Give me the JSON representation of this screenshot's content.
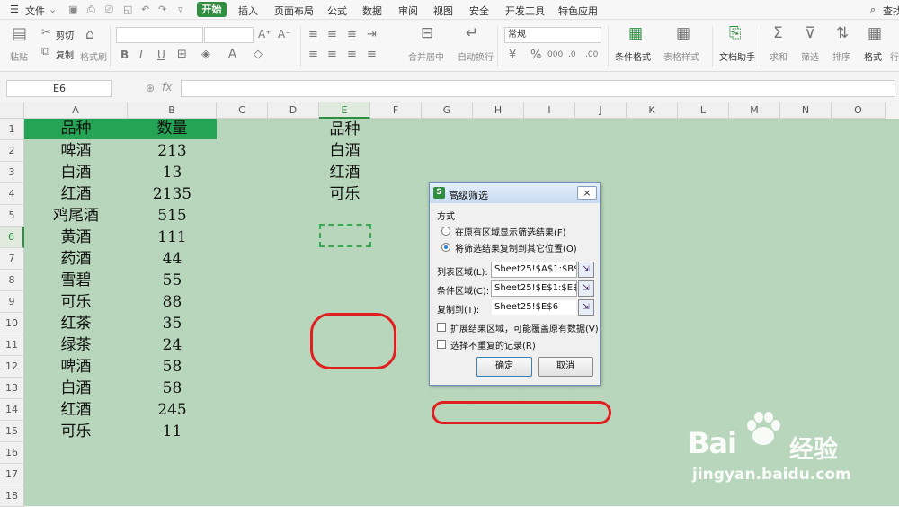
{
  "menubar": {
    "file": "文件",
    "tabs": [
      "开始",
      "插入",
      "页面布局",
      "公式",
      "数据",
      "审阅",
      "视图",
      "安全",
      "开发工具",
      "特色应用"
    ],
    "search": "查找"
  },
  "ribbon": {
    "paste": "粘贴",
    "cut": "剪切",
    "copy": "复制",
    "format_painter": "格式刷",
    "merge_center": "合并居中",
    "wrap": "自动换行",
    "number_format": "常规",
    "conditional_format": "条件格式",
    "table_style": "表格样式",
    "doc_helper": "文档助手",
    "sum": "求和",
    "filter": "筛选",
    "sort": "排序",
    "format": "格式",
    "more": "行"
  },
  "formula_bar": {
    "name_box": "E6",
    "fx": "fx",
    "value": ""
  },
  "grid": {
    "columns": [
      "A",
      "B",
      "C",
      "D",
      "E",
      "F",
      "G",
      "H",
      "I",
      "J",
      "K",
      "L",
      "M",
      "N",
      "O"
    ],
    "rows": [
      "1",
      "2",
      "3",
      "4",
      "5",
      "6",
      "7",
      "8",
      "9",
      "10",
      "11",
      "12",
      "13",
      "14",
      "15",
      "16",
      "17",
      "18"
    ],
    "selected_cell": "E6",
    "header": [
      "品种",
      "数量"
    ],
    "data_a": [
      "啤酒",
      "白酒",
      "红酒",
      "鸡尾酒",
      "黄酒",
      "药酒",
      "雪碧",
      "可乐",
      "红茶",
      "绿茶",
      "啤酒",
      "白酒",
      "红酒",
      "可乐"
    ],
    "data_b": [
      "213",
      "13",
      "2135",
      "515",
      "111",
      "44",
      "55",
      "88",
      "35",
      "24",
      "58",
      "58",
      "245",
      "11"
    ],
    "criteria_e": [
      "品种",
      "白酒",
      "红酒",
      "可乐"
    ]
  },
  "dialog": {
    "title": "高级筛选",
    "close": "×",
    "section": "方式",
    "option1": "在原有区域显示筛选结果(F)",
    "option2": "将筛选结果复制到其它位置(O)",
    "list_label": "列表区域(L):",
    "list_value": "Sheet25!$A$1:$B$1",
    "criteria_label": "条件区域(C):",
    "criteria_value": "Sheet25!$E$1:$E$4",
    "copyto_label": "复制到(T):",
    "copyto_value": "Sheet25!$E$6",
    "extend": "扩展结果区域，可能覆盖原有数据(V)",
    "unique": "选择不重复的记录(R)",
    "ok": "确定",
    "cancel": "取消"
  },
  "watermark": {
    "logo_text": "Bai",
    "logo_cn": "经验",
    "url": "jingyan.baidu.com"
  },
  "colors": {
    "accent": "#2f8e40",
    "header_fill": "#24a454",
    "sheet_bg": "#cce8cf",
    "annotation": "#e02020"
  }
}
